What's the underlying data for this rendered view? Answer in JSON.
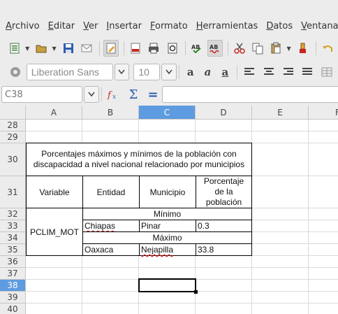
{
  "menu": [
    "Archivo",
    "Editar",
    "Ver",
    "Insertar",
    "Formato",
    "Herramientas",
    "Datos",
    "Ventana"
  ],
  "menu_underline_index": [
    0,
    0,
    0,
    0,
    0,
    0,
    0,
    0
  ],
  "font": {
    "name": "Liberation Sans",
    "size": "10"
  },
  "namebox": {
    "value": "C38"
  },
  "formula": {
    "value": ""
  },
  "columns": [
    "A",
    "B",
    "C",
    "D",
    "E",
    "F"
  ],
  "selected_column": "C",
  "rows": [
    "28",
    "29",
    "30",
    "31",
    "32",
    "33",
    "34",
    "35",
    "36",
    "37",
    "38",
    "39",
    "40"
  ],
  "selected_row": "38",
  "table": {
    "title": "Porcentajes máximos y mínimos de la población con discapacidad a nivel nacional relacionado por municipios",
    "headers": [
      "Variable",
      "Entidad",
      "Municipio",
      "Porcentaje de la población"
    ],
    "variable": "PCLIM_MOT",
    "min_label": "Mínimo",
    "max_label": "Máximo",
    "min_row": [
      "Chiapas",
      "Pinar",
      "0.3"
    ],
    "max_row": [
      "Oaxaca",
      "Nejapilla",
      "33.8"
    ]
  },
  "icons": [
    "new-document-icon",
    "open-folder-icon",
    "save-icon",
    "email-icon",
    "edit-mode-icon",
    "export-pdf-icon",
    "print-icon",
    "print-preview-icon",
    "spellcheck-icon",
    "autospellcheck-icon",
    "cut-icon",
    "copy-icon",
    "paste-icon",
    "clone-format-icon",
    "undo-icon",
    "styles-icon",
    "bold-icon",
    "italic-icon",
    "underline-icon",
    "align-left-icon",
    "align-center-icon",
    "align-right-icon",
    "justify-icon",
    "merge-icon",
    "function-wizard-icon",
    "sum-icon",
    "formula-icon"
  ]
}
